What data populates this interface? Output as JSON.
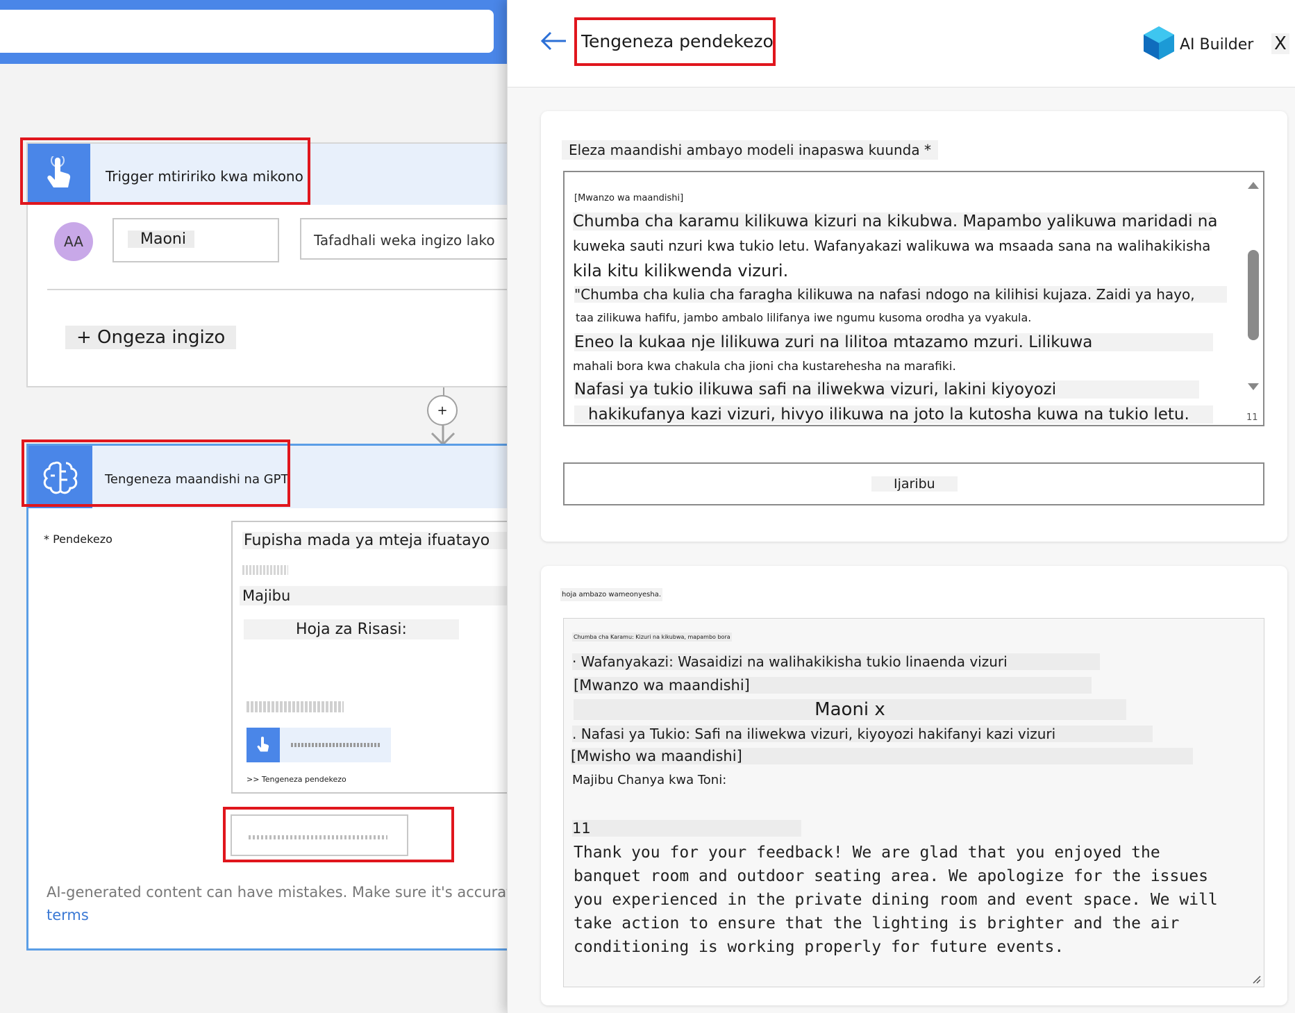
{
  "flow": {
    "trigger": {
      "title": "Trigger mtiririko kwa mikono"
    },
    "inputs": {
      "avatar": "AA",
      "name_value": "Maoni",
      "placeholder": "Tafadhali weka ingizo lako"
    },
    "add_input": "+ Ongeza ingizo",
    "connector": {
      "plus": "+"
    },
    "gpt": {
      "title": "Tengeneza maandishi na GPT"
    },
    "prompt_label": "* Pendekezo",
    "prompt": {
      "line1": "Fupisha mada ya mteja ifuatayo",
      "line2": "Majibu",
      "line3": "Hoja za Risasi:",
      "link": ">> Tengeneza pendekezo"
    },
    "disclaimer": "AI-generated content can have mistakes. Make sure it's accurat",
    "terms": "terms"
  },
  "panel": {
    "title": "Tengeneza pendekezo",
    "brand": "AI Builder",
    "close": "X",
    "prompt_label": "Eleza maandishi ambayo modeli inapaswa kuunda *",
    "prompt_lines": [
      "[Mwanzo wa maandishi]",
      "Chumba cha karamu kilikuwa kizuri na kikubwa. Mapambo yalikuwa maridadi na",
      "kuweka sauti nzuri kwa tukio letu. Wafanyakazi walikuwa wa msaada sana na walihakikisha",
      "kila kitu kilikwenda vizuri.",
      "\"Chumba cha kulia cha faragha kilikuwa na nafasi ndogo na kilihisi kujaza. Zaidi ya hayo,",
      "taa zilikuwa hafifu, jambo ambalo lilifanya iwe ngumu kusoma orodha ya vyakula.",
      "Eneo la kukaa nje lilikuwa zuri na lilitoa mtazamo mzuri. Lilikuwa",
      "mahali bora kwa chakula cha jioni cha kustarehesha na marafiki.",
      "Nafasi ya tukio ilikuwa safi na iliwekwa vizuri, lakini kiyoyozi",
      "hakikufanya kazi vizuri, hivyo ilikuwa na joto la kutosha kuwa na tukio letu."
    ],
    "counter": "11",
    "test_button": "Ijaribu",
    "response_label": "hoja ambazo wameonyesha.",
    "response_lines": [
      "Chumba cha Karamu: Kizuri na kikubwa, mapambo bora",
      "· Wafanyakazi: Wasaidizi na walihakikisha tukio linaenda vizuri",
      "[Mwanzo wa maandishi]",
      "Maoni x",
      ". Nafasi ya Tukio: Safi na iliwekwa vizuri, kiyoyozi hakifanyi kazi vizuri",
      "[Mwisho wa maandishi]",
      "Majibu Chanya kwa Toni:",
      "11"
    ],
    "response_text": [
      "Thank you for your feedback! We are glad that you enjoyed the",
      "banquet room and outdoor seating area. We apologize for the issues",
      "you experienced in the private dining room and event space. We will",
      "take action to ensure that the lighting is brighter and the air",
      "conditioning is working properly for future events."
    ]
  }
}
